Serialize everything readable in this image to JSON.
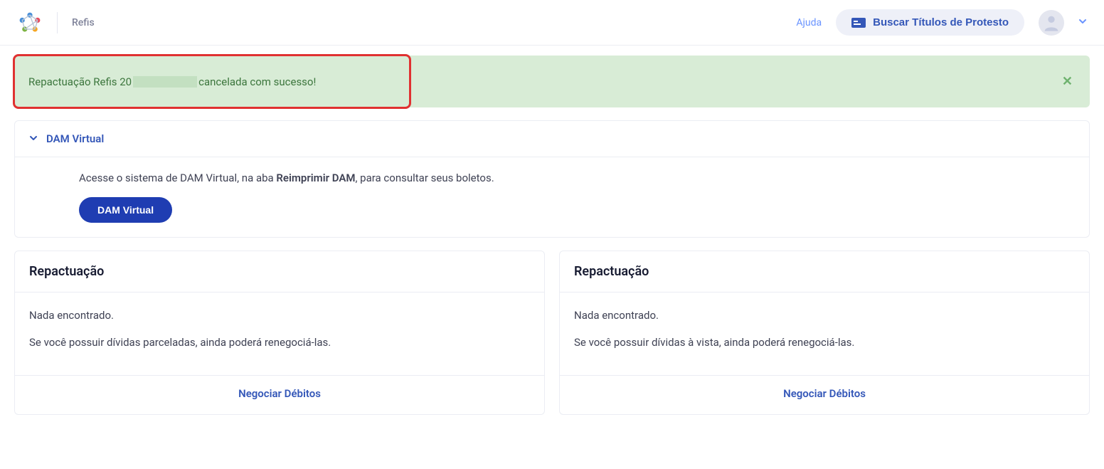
{
  "header": {
    "page_title": "Refis",
    "ajuda_label": "Ajuda",
    "search_button_label": "Buscar Títulos de Protesto"
  },
  "alert": {
    "prefix": "Repactuação Refis 20",
    "suffix": " cancelada com sucesso!"
  },
  "dam_panel": {
    "title": "DAM Virtual",
    "text_before": "Acesse o sistema de DAM Virtual, na aba ",
    "text_bold": "Reimprimir DAM",
    "text_after": ", para consultar seus boletos.",
    "button_label": "DAM Virtual"
  },
  "cards": [
    {
      "title": "Repactuação",
      "line1": "Nada encontrado.",
      "line2": "Se você possuir dívidas parceladas, ainda poderá renegociá-las.",
      "footer_link": "Negociar Débitos"
    },
    {
      "title": "Repactuação",
      "line1": "Nada encontrado.",
      "line2": "Se você possuir dívidas à vista, ainda poderá renegociá-las.",
      "footer_link": "Negociar Débitos"
    }
  ]
}
